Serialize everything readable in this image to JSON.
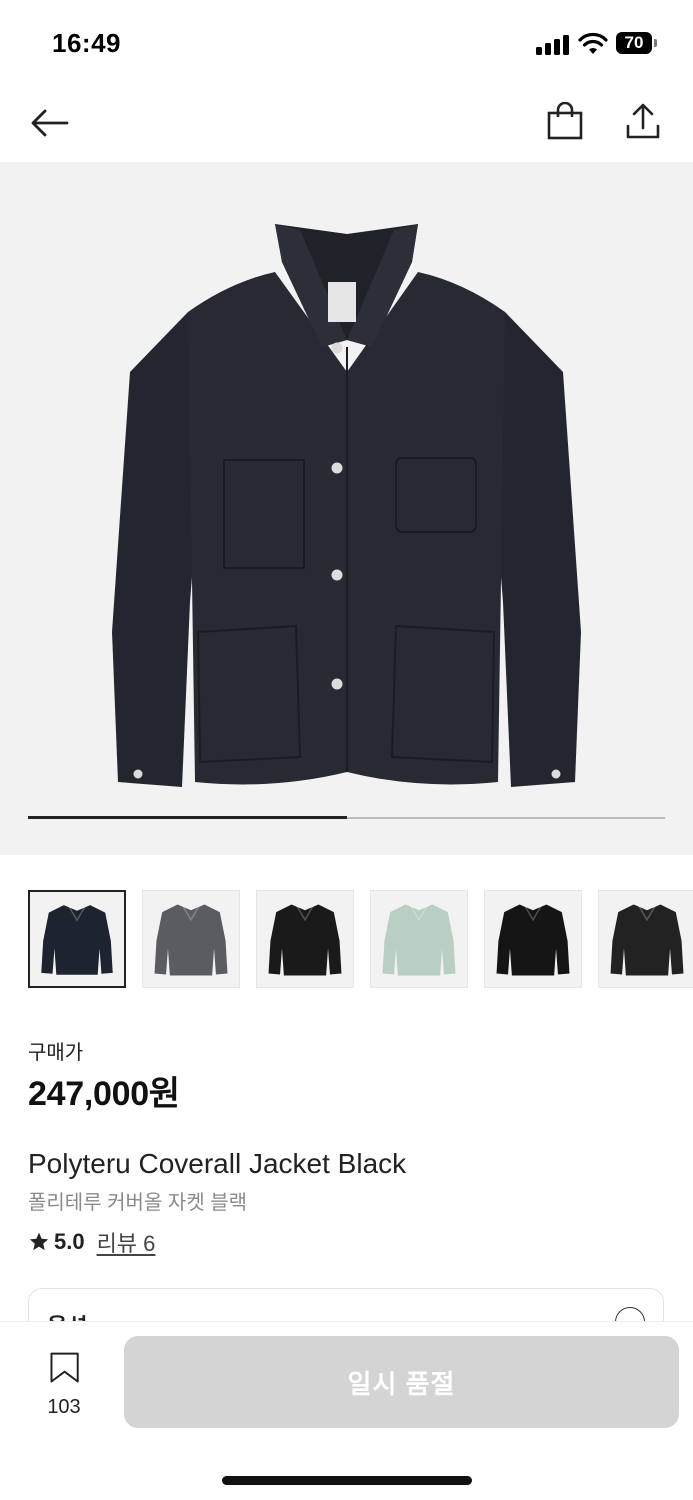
{
  "status_bar": {
    "time": "16:49",
    "battery": "70"
  },
  "header": {
    "back_icon": "arrow-left-icon",
    "bag_icon": "shopping-bag-icon",
    "share_icon": "share-icon"
  },
  "hero": {
    "current_slide": 1,
    "total_slides": 2,
    "progress_fraction": 0.5
  },
  "thumbnails": [
    {
      "name": "black jacket",
      "color": "#1e2330",
      "selected": true
    },
    {
      "name": "grey jacket",
      "color": "#5a5c62",
      "selected": false
    },
    {
      "name": "black jacket 2",
      "color": "#1a1a1a",
      "selected": false
    },
    {
      "name": "mint jacket",
      "color": "#b9cfc3",
      "selected": false
    },
    {
      "name": "black jacket 3",
      "color": "#151515",
      "selected": false
    },
    {
      "name": "black jacket 4",
      "color": "#222222",
      "selected": false
    }
  ],
  "product": {
    "price_label": "구매가",
    "price": "247,000원",
    "name_en": "Polyteru Coverall Jacket Black",
    "name_kr": "폴리테루 커버올 자켓 블랙",
    "rating": "5.0",
    "review_link": "리뷰 6"
  },
  "option": {
    "label": "옵션"
  },
  "bottom_bar": {
    "wish_count": "103",
    "cta_label": "일시 품절"
  }
}
